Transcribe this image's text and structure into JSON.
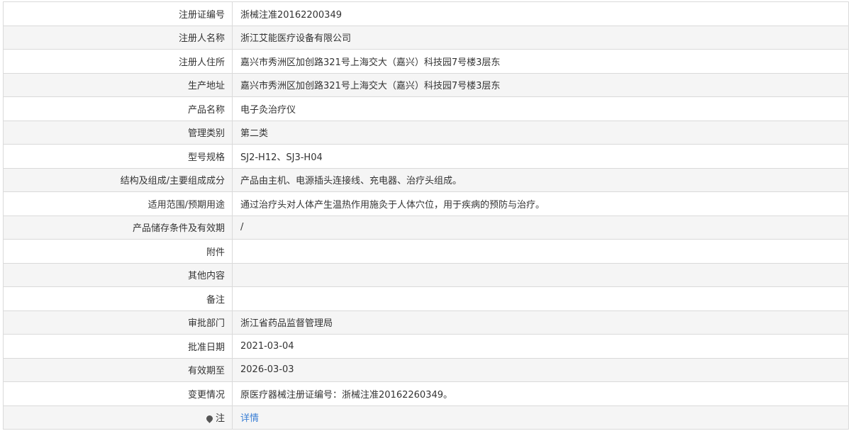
{
  "rows": [
    {
      "label": "注册证编号",
      "value": "浙械注准20162200349"
    },
    {
      "label": "注册人名称",
      "value": "浙江艾能医疗设备有限公司"
    },
    {
      "label": "注册人住所",
      "value": "嘉兴市秀洲区加创路321号上海交大（嘉兴）科技园7号楼3层东"
    },
    {
      "label": "生产地址",
      "value": "嘉兴市秀洲区加创路321号上海交大（嘉兴）科技园7号楼3层东"
    },
    {
      "label": "产品名称",
      "value": "电子灸治疗仪"
    },
    {
      "label": "管理类别",
      "value": "第二类"
    },
    {
      "label": "型号规格",
      "value": "SJ2-H12、SJ3-H04"
    },
    {
      "label": "结构及组成/主要组成成分",
      "value": "产品由主机、电源插头连接线、充电器、治疗头组成。"
    },
    {
      "label": "适用范围/预期用途",
      "value": "通过治疗头对人体产生温热作用施灸于人体穴位，用于疾病的预防与治疗。"
    },
    {
      "label": "产品储存条件及有效期",
      "value": "/"
    },
    {
      "label": "附件",
      "value": ""
    },
    {
      "label": "其他内容",
      "value": ""
    },
    {
      "label": "备注",
      "value": ""
    },
    {
      "label": "审批部门",
      "value": "浙江省药品监督管理局"
    },
    {
      "label": "批准日期",
      "value": "2021-03-04"
    },
    {
      "label": "有效期至",
      "value": "2026-03-03"
    },
    {
      "label": "变更情况",
      "value": "原医疗器械注册证编号：浙械注准20162260349。"
    }
  ],
  "note_row": {
    "icon": "pin-icon",
    "label": "注",
    "link_text": "详情",
    "link_color": "#3a7fd5"
  }
}
